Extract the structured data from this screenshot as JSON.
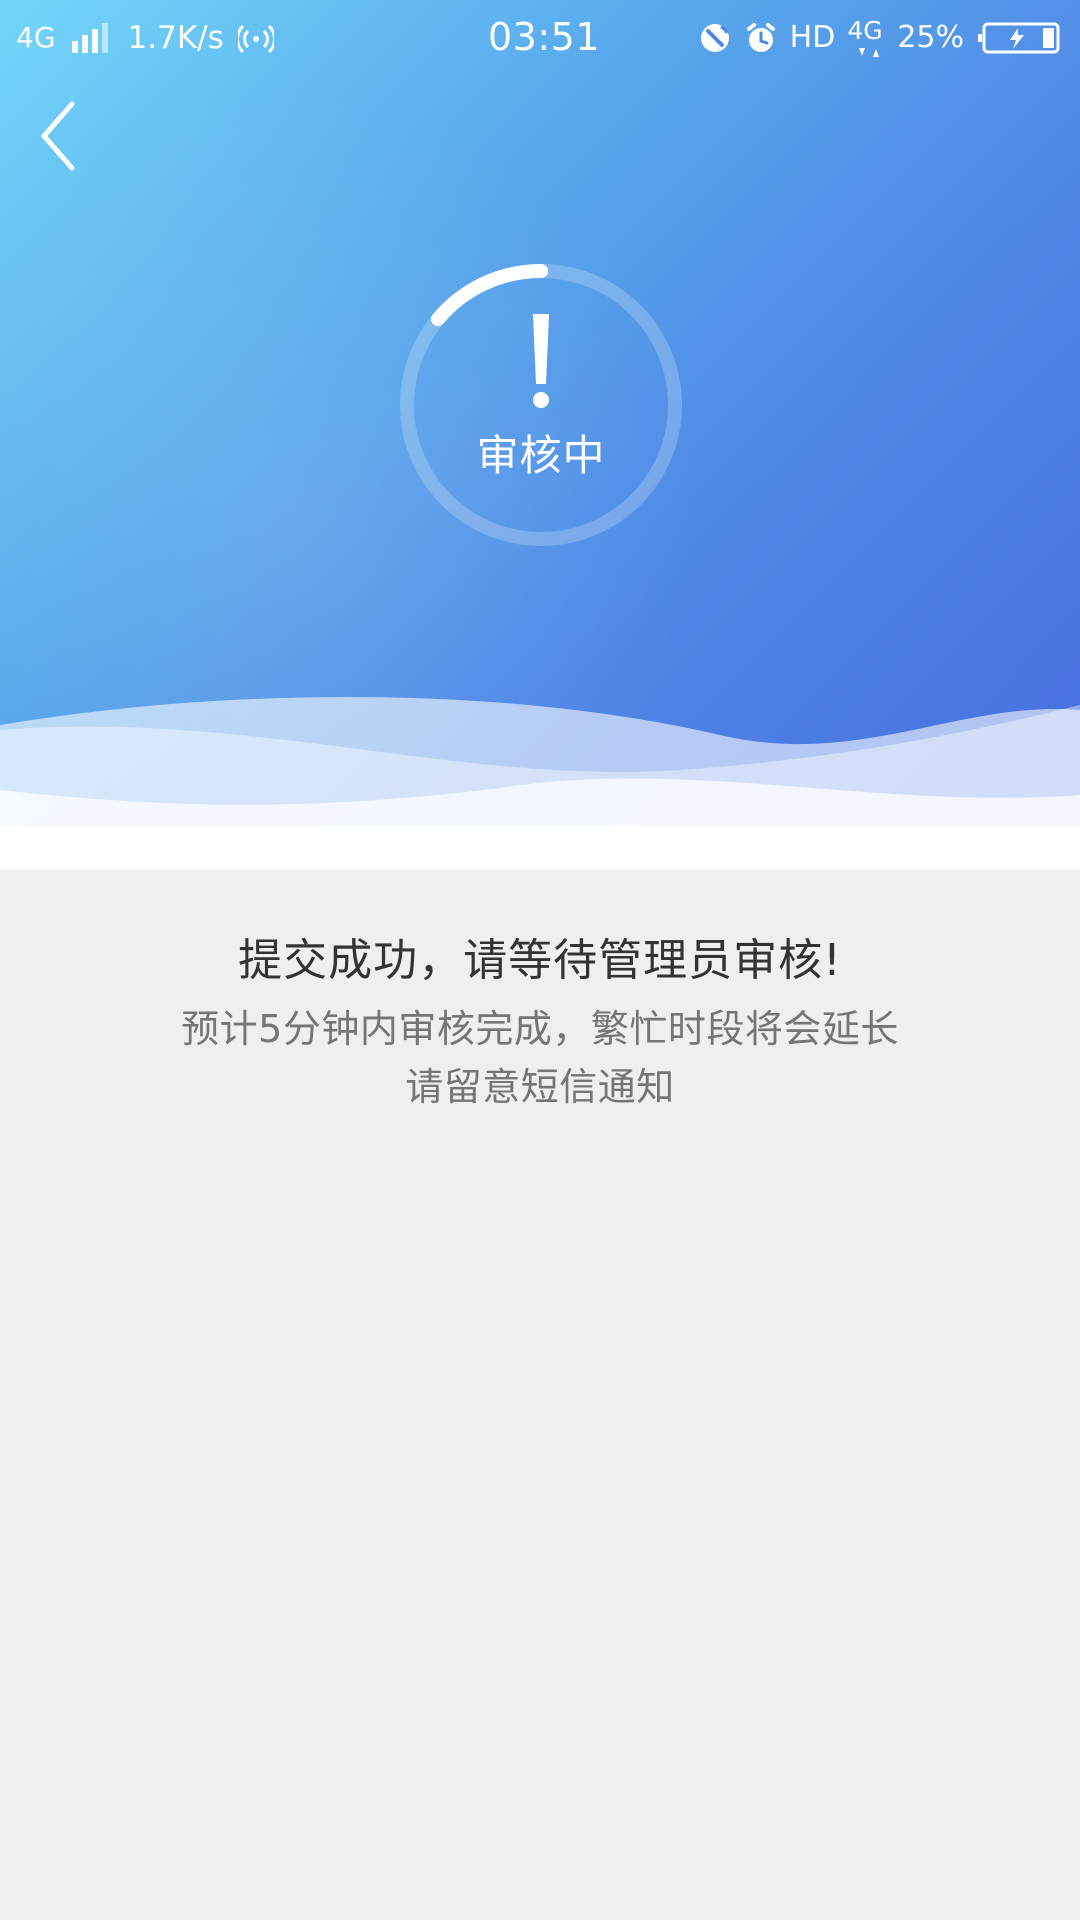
{
  "status_bar": {
    "network": "4G",
    "speed": "1.7K/s",
    "time": "03:51",
    "hd": "HD",
    "network_type": "4G",
    "battery": "25%",
    "icons": [
      "signal-icon",
      "hotspot-icon",
      "do-not-disturb-icon",
      "alarm-icon",
      "data-arrows-icon",
      "battery-charging-icon"
    ]
  },
  "header": {
    "back_icon": "chevron-left-icon"
  },
  "review_status": {
    "icon": "exclamation-icon",
    "label": "审核中"
  },
  "message": {
    "title": "提交成功，请等待管理员审核!",
    "line1": "预计5分钟内审核完成，繁忙时段将会延长",
    "line2": "请留意短信通知"
  },
  "colors": {
    "hero_gradient_start": "#72d6f8",
    "hero_gradient_end": "#466ddf",
    "page_background": "#efefef",
    "title_text": "#333333",
    "secondary_text": "#757575"
  }
}
